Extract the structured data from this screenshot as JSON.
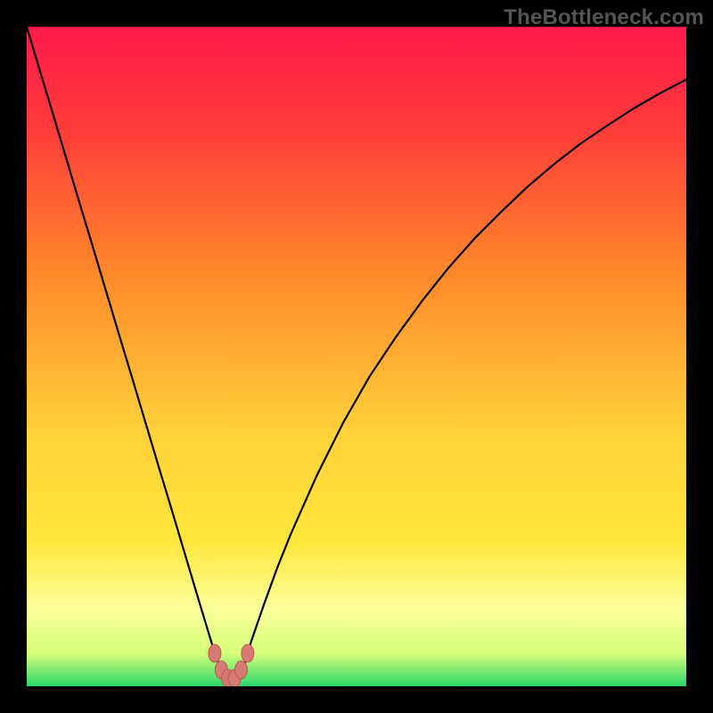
{
  "watermark": "TheBottleneck.com",
  "icons": {
    "watermark": "thebottleneck-watermark"
  },
  "colors": {
    "black": "#000000",
    "curve": "#000000",
    "marker_fill": "#d77a74",
    "marker_stroke": "#bb5a54",
    "gradient_top": "#ff1a4b",
    "gradient_mid_orange": "#ff8a2a",
    "gradient_yellow": "#ffe63a",
    "gradient_pale_yellow": "#fcff9a",
    "gradient_green": "#2bd86b"
  },
  "chart_data": {
    "type": "line",
    "title": "",
    "xlabel": "",
    "ylabel": "",
    "x": [
      0.0,
      0.02,
      0.04,
      0.06,
      0.08,
      0.1,
      0.12,
      0.14,
      0.16,
      0.18,
      0.2,
      0.22,
      0.24,
      0.26,
      0.28,
      0.285,
      0.29,
      0.295,
      0.3,
      0.305,
      0.31,
      0.315,
      0.32,
      0.33,
      0.335,
      0.34,
      0.36,
      0.38,
      0.4,
      0.44,
      0.48,
      0.52,
      0.56,
      0.6,
      0.64,
      0.68,
      0.72,
      0.76,
      0.8,
      0.84,
      0.88,
      0.92,
      0.96,
      1.0
    ],
    "y": [
      1.0,
      0.933,
      0.867,
      0.8,
      0.733,
      0.667,
      0.6,
      0.533,
      0.467,
      0.4,
      0.333,
      0.267,
      0.2,
      0.133,
      0.067,
      0.05,
      0.037,
      0.025,
      0.017,
      0.012,
      0.01,
      0.012,
      0.017,
      0.033,
      0.05,
      0.067,
      0.125,
      0.18,
      0.23,
      0.32,
      0.4,
      0.47,
      0.53,
      0.585,
      0.635,
      0.68,
      0.72,
      0.758,
      0.792,
      0.823,
      0.85,
      0.876,
      0.899,
      0.92
    ],
    "xlim": [
      0,
      1
    ],
    "ylim": [
      0,
      1
    ],
    "markers": [
      {
        "x": 0.285,
        "y": 0.05
      },
      {
        "x": 0.295,
        "y": 0.025
      },
      {
        "x": 0.305,
        "y": 0.012
      },
      {
        "x": 0.315,
        "y": 0.012
      },
      {
        "x": 0.325,
        "y": 0.025
      },
      {
        "x": 0.335,
        "y": 0.05
      }
    ],
    "background": {
      "type": "vertical-gradient",
      "stops": [
        {
          "offset": 0.0,
          "color": "#ff1a4b"
        },
        {
          "offset": 0.15,
          "color": "#ff3a3a"
        },
        {
          "offset": 0.38,
          "color": "#ff8a2a"
        },
        {
          "offset": 0.62,
          "color": "#ffd23a"
        },
        {
          "offset": 0.78,
          "color": "#ffe63a"
        },
        {
          "offset": 0.88,
          "color": "#fcff9a"
        },
        {
          "offset": 0.95,
          "color": "#d7ff7a"
        },
        {
          "offset": 1.0,
          "color": "#2bd86b"
        }
      ]
    }
  }
}
